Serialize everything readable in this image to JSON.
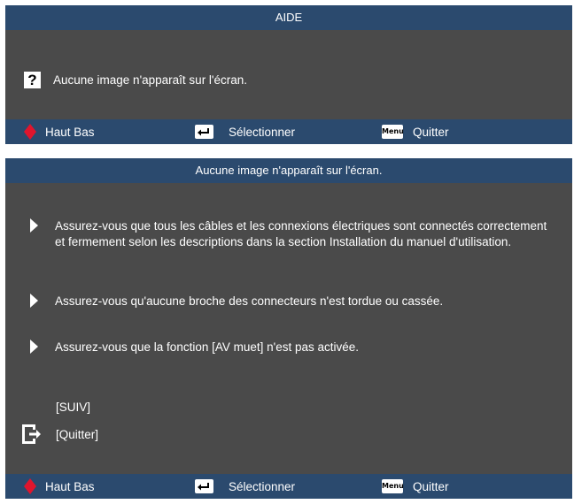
{
  "help_panel": {
    "title": "AIDE",
    "question_icon": "question-icon",
    "question_text": "Aucune image n'apparaît sur l'écran."
  },
  "footer": {
    "nav_icon": "up-down-arrows-icon",
    "nav_label": "Haut Bas",
    "select_icon": "enter-key-icon",
    "select_label": "Sélectionner",
    "menu_icon": "menu-key-icon",
    "menu_key_text": "Menu",
    "quit_label": "Quitter"
  },
  "detail_panel": {
    "title": "Aucune image n'apparaît sur l'écran.",
    "tips": [
      "Assurez-vous que tous les câbles et les connexions électriques sont connectés correctement et fermement selon les descriptions dans la section Installation du manuel d'utilisation.",
      "Assurez-vous qu'aucune broche des connecteurs n'est tordue ou cassée.",
      "Assurez-vous que la fonction [AV muet] n'est pas activée."
    ],
    "next_label": "[SUIV]",
    "quit_label": "[Quitter]",
    "exit_icon": "exit-icon"
  },
  "colors": {
    "title_bar": "#2b4a6e",
    "panel_bg": "#4a4a4a",
    "arrow_red": "#e0152d"
  }
}
